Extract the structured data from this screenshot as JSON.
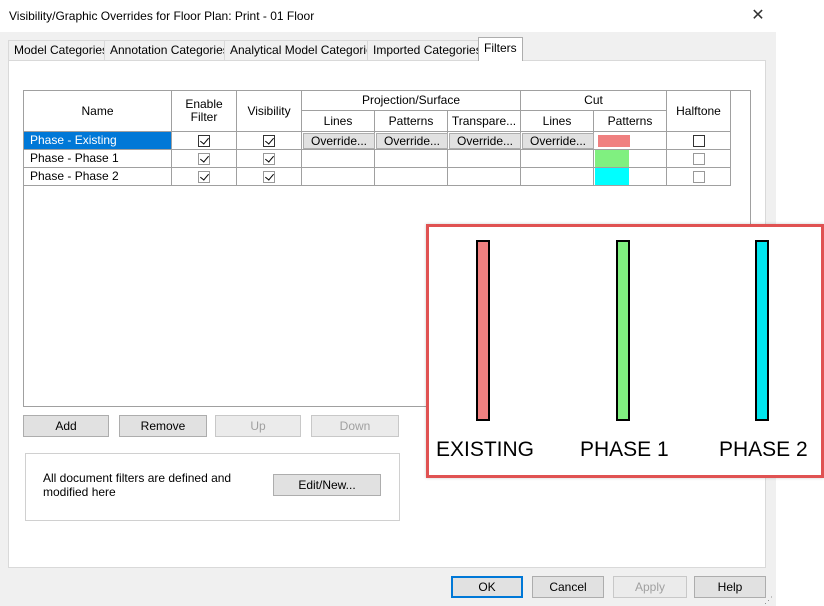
{
  "window": {
    "title": "Visibility/Graphic Overrides for Floor Plan: Print - 01 Floor",
    "close_glyph": "✕"
  },
  "tabs": [
    {
      "label": "Model Categories"
    },
    {
      "label": "Annotation Categories"
    },
    {
      "label": "Analytical Model Categories"
    },
    {
      "label": "Imported Categories"
    },
    {
      "label": "Filters",
      "active": true
    }
  ],
  "grid": {
    "headers": {
      "name": "Name",
      "enable_filter": "Enable Filter",
      "visibility": "Visibility",
      "projection_surface": "Projection/Surface",
      "proj_lines": "Lines",
      "proj_patterns": "Patterns",
      "proj_transparency": "Transpare...",
      "cut": "Cut",
      "cut_lines": "Lines",
      "cut_patterns": "Patterns",
      "halftone": "Halftone"
    },
    "override_label": "Override...",
    "rows": [
      {
        "name": "Phase - Existing",
        "enable_filter": true,
        "visibility": true,
        "cut_pattern_color": "#f08080",
        "halftone": false,
        "selected": true
      },
      {
        "name": "Phase - Phase 1",
        "enable_filter": true,
        "visibility": true,
        "cut_pattern_color": "#80f080",
        "halftone": false,
        "selected": false
      },
      {
        "name": "Phase - Phase 2",
        "enable_filter": true,
        "visibility": true,
        "cut_pattern_color": "#00ffff",
        "halftone": false,
        "selected": false
      }
    ]
  },
  "list_buttons": {
    "add": "Add",
    "remove": "Remove",
    "up": "Up",
    "down": "Down"
  },
  "filter_box": {
    "note": "All document filters are defined and modified here",
    "edit_new": "Edit/New..."
  },
  "footer": {
    "ok": "OK",
    "cancel": "Cancel",
    "apply": "Apply",
    "help": "Help"
  },
  "legend": {
    "items": [
      {
        "label": "EXISTING",
        "color": "#f08080"
      },
      {
        "label": "PHASE 1",
        "color": "#80f080"
      },
      {
        "label": "PHASE 2",
        "color": "#00e5ee"
      }
    ]
  },
  "colors": {
    "selection": "#0078d7",
    "legend_border": "#e05252"
  }
}
